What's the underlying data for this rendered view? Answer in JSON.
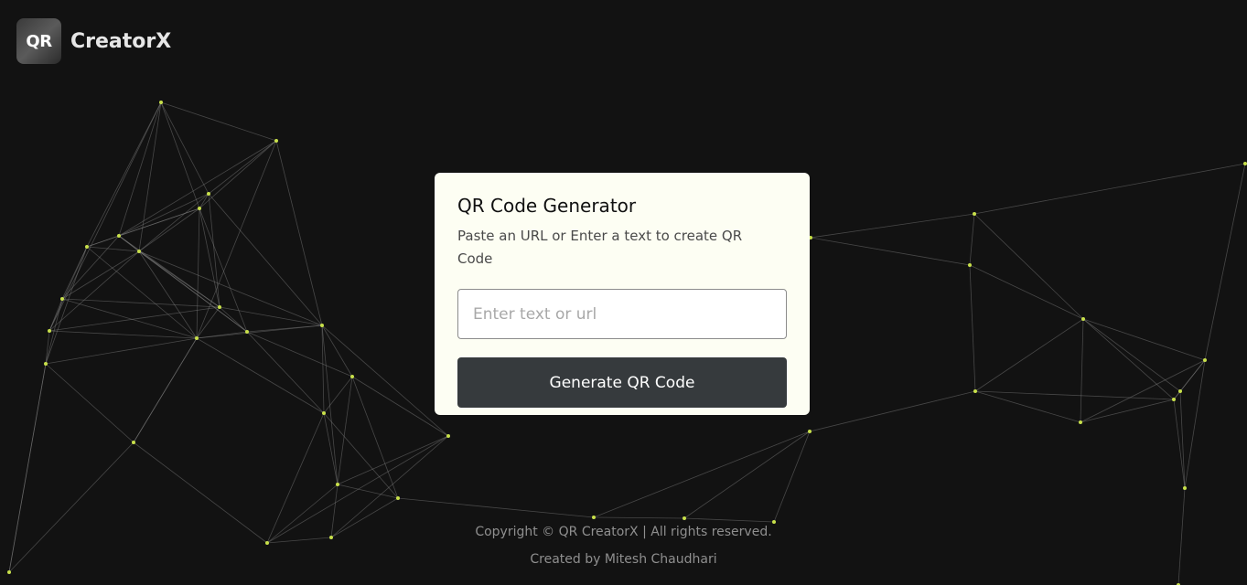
{
  "logo": {
    "badge": "QR",
    "name": "CreatorX"
  },
  "card": {
    "title": "QR Code Generator",
    "subtitle": "Paste an URL or Enter a text to create QR Code",
    "input_placeholder": "Enter text or url",
    "input_value": "",
    "button_label": "Generate QR Code"
  },
  "footer": {
    "copyright": "Copyright © QR CreatorX | All rights reserved.",
    "credit": "Created by Mitesh Chaudhari"
  },
  "colors": {
    "background": "#121212",
    "card": "#fdfef3",
    "button": "#363a3d",
    "network_node": "#c8e04a",
    "network_line": "#8a8a8a"
  }
}
